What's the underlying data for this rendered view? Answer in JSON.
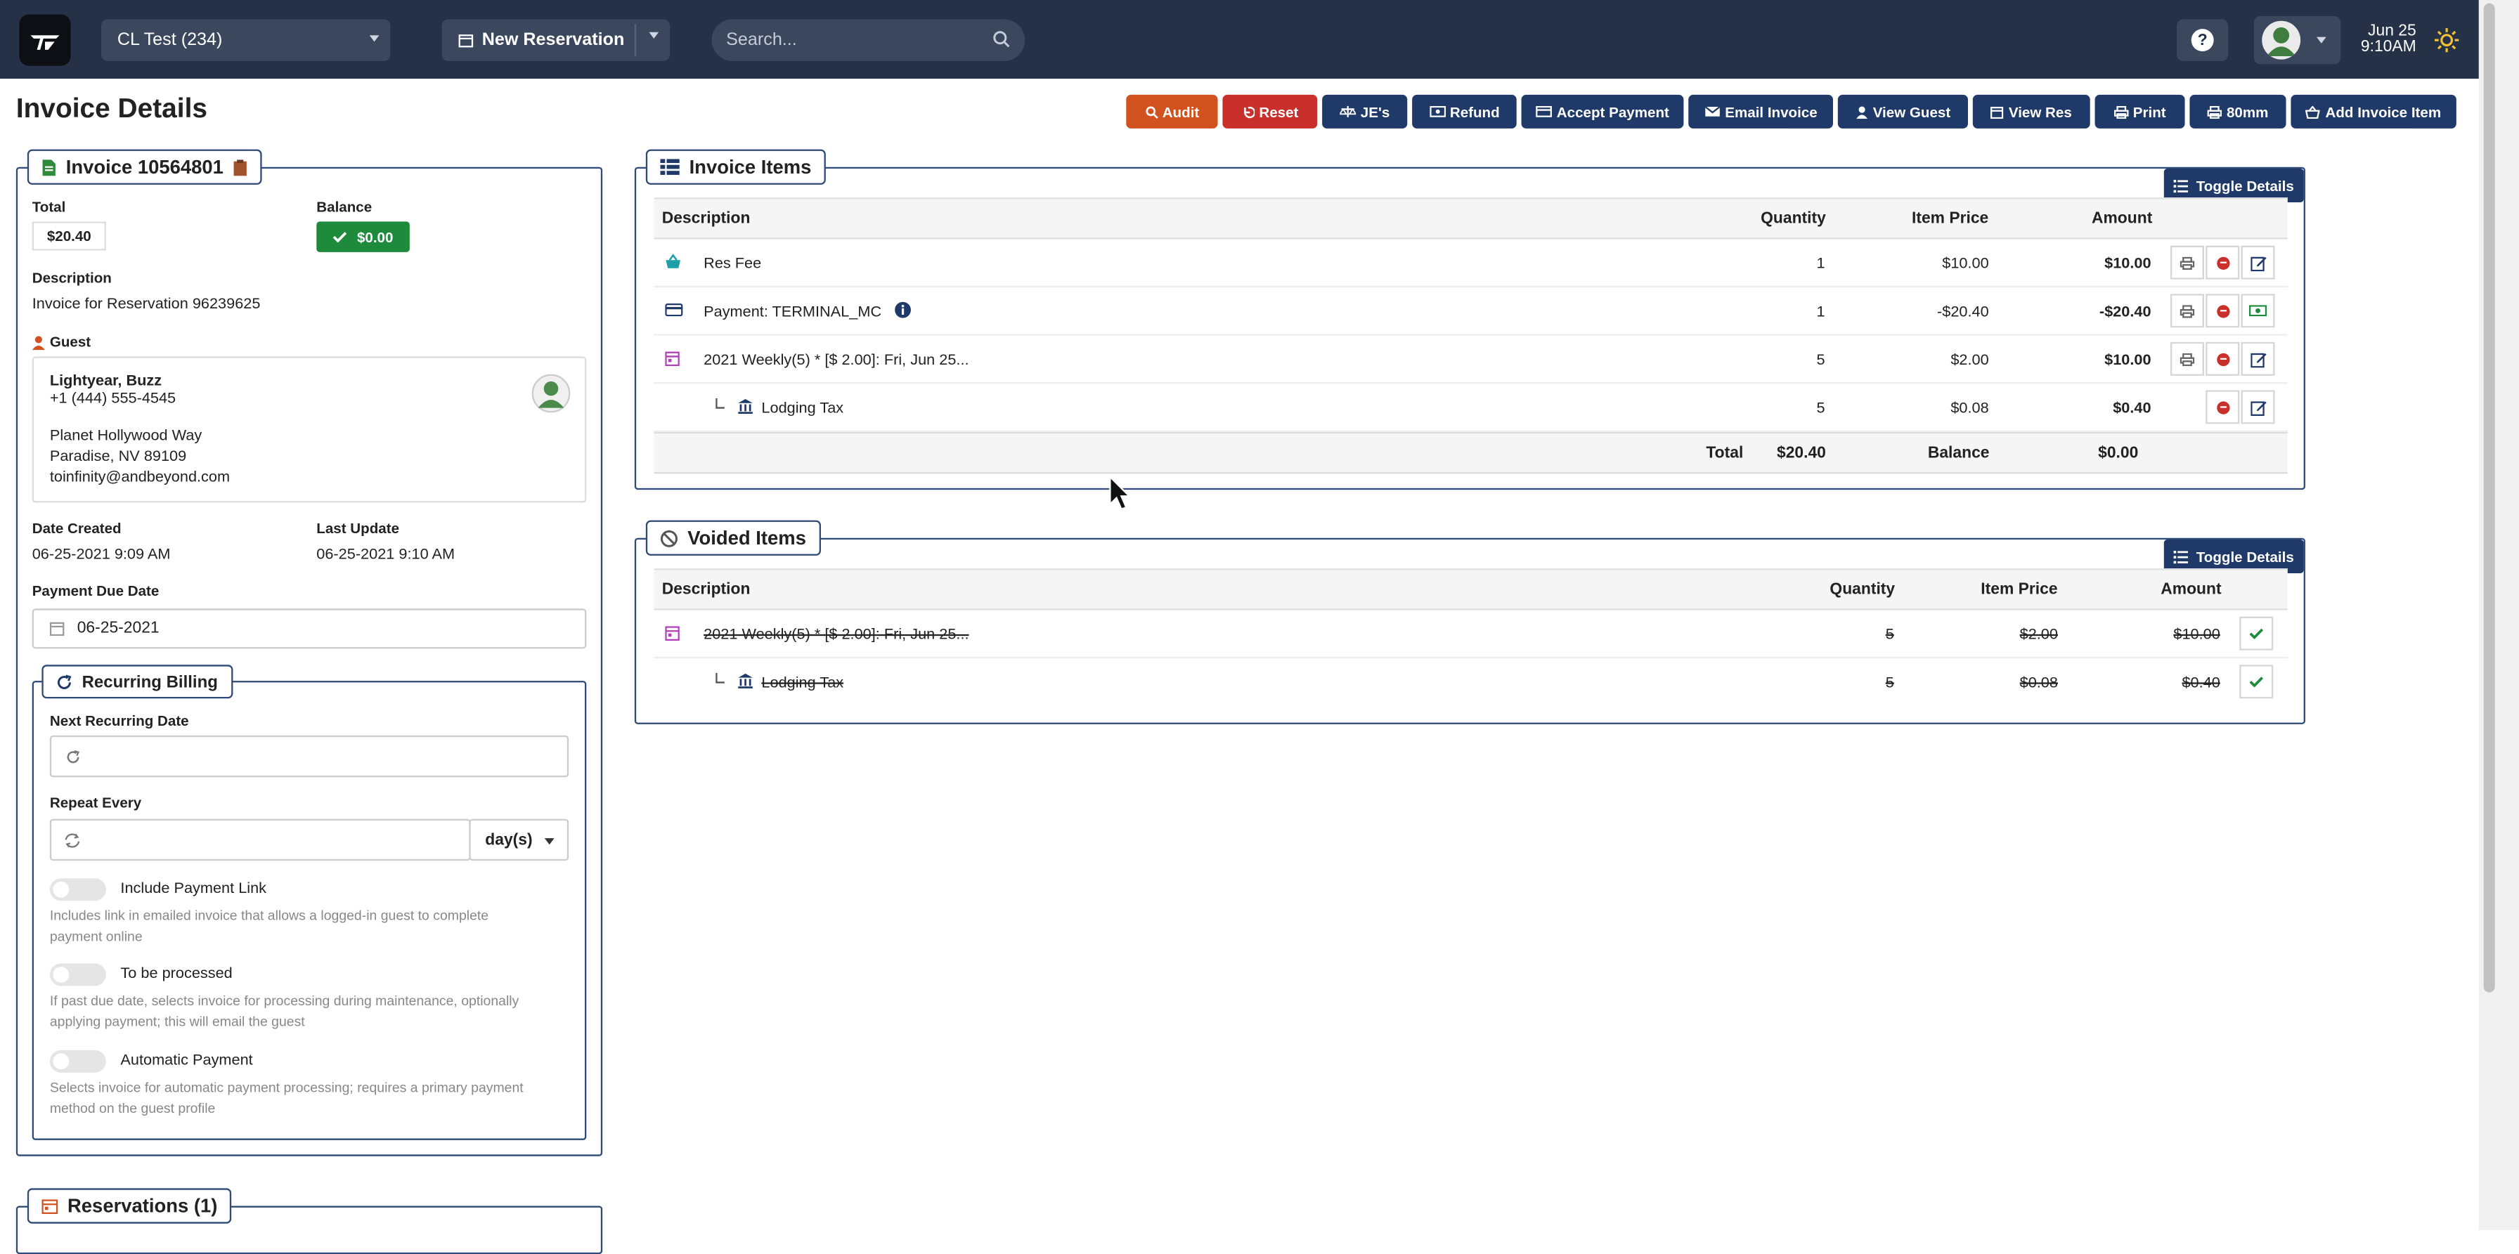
{
  "topbar": {
    "property": "CL Test (234)",
    "new_reservation": "New Reservation",
    "search_placeholder": "Search...",
    "help": "?",
    "date": "Jun 25",
    "time": "9:10AM"
  },
  "page": {
    "title": "Invoice Details"
  },
  "actions": {
    "audit": "Audit",
    "reset": "Reset",
    "jes": "JE's",
    "refund": "Refund",
    "accept_payment": "Accept Payment",
    "email_invoice": "Email Invoice",
    "view_guest": "View Guest",
    "view_res": "View Res",
    "print": "Print",
    "print_80mm": "80mm",
    "add_invoice_item": "Add Invoice Item"
  },
  "invoice": {
    "legend": "Invoice 10564801",
    "total_label": "Total",
    "total_value": "$20.40",
    "balance_label": "Balance",
    "balance_value": "$0.00",
    "description_label": "Description",
    "description_value": "Invoice for Reservation 96239625",
    "guest_label": "Guest",
    "guest": {
      "name": "Lightyear, Buzz",
      "phone": "+1 (444) 555-4545",
      "address1": "Planet Hollywood Way",
      "address2": "Paradise, NV 89109",
      "email": "toinfinity@andbeyond.com"
    },
    "date_created_label": "Date Created",
    "date_created_value": "06-25-2021 9:09 AM",
    "last_update_label": "Last Update",
    "last_update_value": "06-25-2021 9:10 AM",
    "payment_due_label": "Payment Due Date",
    "payment_due_value": "06-25-2021"
  },
  "recurring": {
    "legend": "Recurring Billing",
    "next_date_label": "Next Recurring Date",
    "repeat_every_label": "Repeat Every",
    "repeat_unit": "day(s)",
    "include_link_label": "Include Payment Link",
    "include_link_help": "Includes link in emailed invoice that allows a logged-in guest to complete payment online",
    "to_be_processed_label": "To be processed",
    "to_be_processed_help": "If past due date, selects invoice for processing during maintenance, optionally applying payment; this will email the guest",
    "auto_payment_label": "Automatic Payment",
    "auto_payment_help": "Selects invoice for automatic payment processing; requires a primary payment method on the guest profile"
  },
  "reservations": {
    "legend": "Reservations (1)"
  },
  "invoice_items": {
    "legend": "Invoice Items",
    "toggle_details": "Toggle Details",
    "headers": {
      "description": "Description",
      "quantity": "Quantity",
      "item_price": "Item Price",
      "amount": "Amount"
    },
    "rows": [
      {
        "description": "Res Fee",
        "quantity": "1",
        "price": "$10.00",
        "amount": "$10.00"
      },
      {
        "description": "Payment: TERMINAL_MC",
        "quantity": "1",
        "price": "-$20.40",
        "amount": "-$20.40"
      },
      {
        "description": "2021 Weekly(5) * [$ 2.00]: Fri, Jun 25...",
        "quantity": "5",
        "price": "$2.00",
        "amount": "$10.00"
      },
      {
        "description": "Lodging Tax",
        "quantity": "5",
        "price": "$0.08",
        "amount": "$0.40"
      }
    ],
    "footer": {
      "total_label": "Total",
      "total_value": "$20.40",
      "balance_label": "Balance",
      "balance_value": "$0.00"
    }
  },
  "voided_items": {
    "legend": "Voided Items",
    "toggle_details": "Toggle Details",
    "headers": {
      "description": "Description",
      "quantity": "Quantity",
      "item_price": "Item Price",
      "amount": "Amount"
    },
    "rows": [
      {
        "description": "2021 Weekly(5) * [$ 2.00]: Fri, Jun 25...",
        "quantity": "5",
        "price": "$2.00",
        "amount": "$10.00"
      },
      {
        "description": "Lodging Tax",
        "quantity": "5",
        "price": "$0.08",
        "amount": "$0.40"
      }
    ]
  },
  "colors": {
    "topbar": "#243147",
    "primary": "#1f3a68",
    "audit": "#d2521f",
    "reset": "#c9302c",
    "success": "#1e8a3c"
  }
}
